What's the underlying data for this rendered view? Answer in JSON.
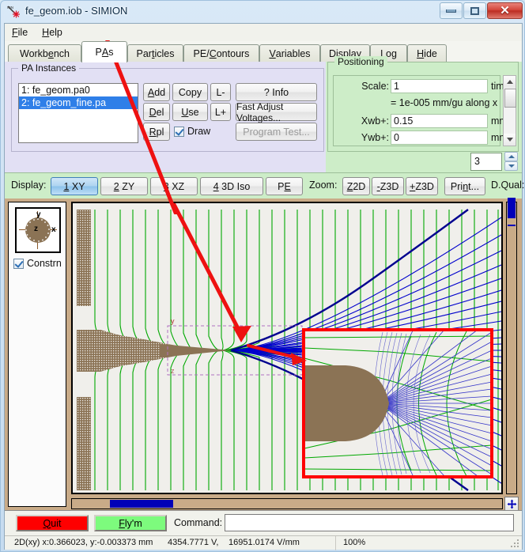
{
  "window": {
    "title": "fe_geom.iob - SIMION",
    "icon": "simion-ion-icon",
    "minimize_label": "minimize-icon",
    "maximize_label": "maximize-icon",
    "close_label": "✕"
  },
  "menu": {
    "items": [
      {
        "label": "File",
        "mnemonic": "F"
      },
      {
        "label": "Help",
        "mnemonic": "H"
      }
    ]
  },
  "tabs": {
    "items": [
      {
        "label": "Workbench",
        "pre": "Workb",
        "mn": "e",
        "post": "nch",
        "active": false
      },
      {
        "label": "PAs",
        "pre": "P",
        "mn": "A",
        "post": "s",
        "active": true
      },
      {
        "label": "Particles",
        "pre": "Par",
        "mn": "t",
        "post": "icles",
        "active": false
      },
      {
        "label": "PE/Contours",
        "pre": "PE/",
        "mn": "C",
        "post": "ontours",
        "active": false
      },
      {
        "label": "Variables",
        "pre": "",
        "mn": "V",
        "post": "ariables",
        "active": false
      },
      {
        "label": "Display",
        "pre": "Displa",
        "mn": "y",
        "post": "",
        "active": false
      },
      {
        "label": "Log",
        "pre": "Lo",
        "mn": "g",
        "post": "",
        "active": false
      },
      {
        "label": "Hide",
        "pre": "",
        "mn": "H",
        "post": "ide",
        "active": false
      }
    ]
  },
  "pa_instances": {
    "group_title": "PA Instances",
    "list": [
      {
        "label": "1: fe_geom.pa0",
        "selected": false
      },
      {
        "label": "2: fe_geom_fine.pa",
        "selected": true
      }
    ],
    "buttons": {
      "add": "Add",
      "copy": "Copy",
      "lminus": "L-",
      "info": "? Info",
      "del": "Del",
      "use": "Use",
      "lplus": "L+",
      "fast_adjust": "Fast Adjust Voltages...",
      "rpl": "Rpl",
      "program_test": "Program Test..."
    },
    "draw_checkbox": {
      "label": "Draw",
      "checked": true
    }
  },
  "positioning": {
    "group_title": "Positioning",
    "scale_label": "Scale:",
    "scale_value": "1",
    "scale_unit": "times",
    "scale_note": "= 1e-005 mm/gu along x",
    "xwb_label": "Xwb+:",
    "xwb_value": "0.15",
    "xwb_unit": "mm",
    "ywb_label": "Ywb+:",
    "ywb_value": "0",
    "ywb_unit": "mm"
  },
  "display_bar": {
    "display_label": "Display:",
    "views": [
      {
        "num": "1",
        "label": " XY",
        "active": true
      },
      {
        "num": "2",
        "label": " ZY",
        "active": false
      },
      {
        "num": "3",
        "label": " XZ",
        "active": false
      },
      {
        "num": "4",
        "label": " 3D Iso",
        "active": false
      }
    ],
    "pe_button": {
      "pre": "P",
      "mn": "E",
      "post": ""
    },
    "zoom_label": "Zoom:",
    "zoom_buttons": [
      {
        "pre": "",
        "mn": "Z",
        "post": "2D"
      },
      {
        "pre": "",
        "mn": "-",
        "post": "Z3D"
      },
      {
        "pre": "",
        "mn": "+",
        "post": "Z3D"
      }
    ],
    "print_button": {
      "pre": "Pri",
      "mn": "n",
      "post": "t..."
    },
    "dqual_label": "D.Qual:",
    "dqual_value": "3"
  },
  "viewer": {
    "axis_widget": {
      "x": "x",
      "y": "y",
      "z": "z"
    },
    "constrn_checkbox": {
      "label": "Constrn",
      "checked": true
    },
    "pan_icon": "pan-move-icon",
    "annotations": {
      "arrow_to_list": "red-arrow-pointing-to-selected-pa",
      "arrow_to_inset": "red-arrow-pointing-to-zoom-inset",
      "inset_border_color": "#ff0000"
    },
    "colors": {
      "field_line_green": "#00b000",
      "contour_blue": "#0000cd",
      "electrode_brown": "#8b7355",
      "canvas_bg": "#f0efeb",
      "frame_tan": "#c9ab88"
    }
  },
  "bottom": {
    "quit_button": {
      "pre": "",
      "mn": "Q",
      "post": "uit"
    },
    "fly_button": {
      "pre": "",
      "mn": "F",
      "post": "ly'm"
    },
    "command_label": "Command:",
    "command_value": "",
    "command_placeholder": ""
  },
  "status": {
    "coords": "2D(xy) x:0.366023, y:-0.003373 mm",
    "voltage": "4354.7771 V,",
    "gradient": "16951.0174 V/mm",
    "zoom_percent": "100%"
  }
}
